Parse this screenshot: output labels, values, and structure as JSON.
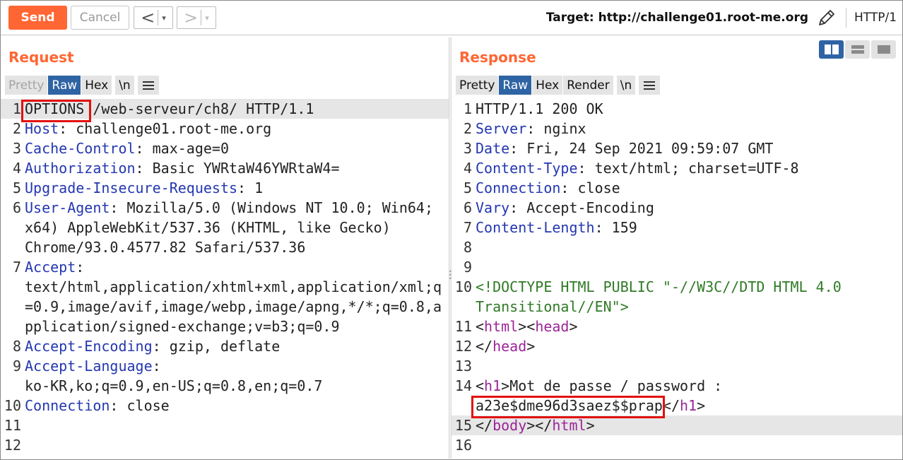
{
  "toolbar": {
    "send_label": "Send",
    "cancel_label": "Cancel",
    "back_arrow": "<",
    "forward_arrow": ">",
    "dropdown_arrow": "▾",
    "target_label": "Target: http://challenge01.root-me.org",
    "protocol_label": "HTTP/1"
  },
  "request": {
    "title": "Request",
    "tabs": [
      "Pretty",
      "Raw",
      "Hex",
      "\\n"
    ],
    "selected_tab": "Raw",
    "lines": [
      {
        "num": "1",
        "key": "OPTIONS",
        "rest": " /web-serveur/ch8/ HTTP/1.1"
      },
      {
        "num": "2",
        "key": "Host",
        "rest": ": challenge01.root-me.org"
      },
      {
        "num": "3",
        "key": "Cache-Control",
        "rest": ": max-age=0"
      },
      {
        "num": "4",
        "key": "Authorization",
        "rest": ": Basic YWRtaW46YWRtaW4="
      },
      {
        "num": "5",
        "key": "Upgrade-Insecure-Requests",
        "rest": ": 1"
      },
      {
        "num": "6",
        "key": "User-Agent",
        "rest": ": Mozilla/5.0 (Windows NT 10.0; Win64;"
      },
      {
        "num": "",
        "key": "",
        "rest": "x64) AppleWebKit/537.36 (KHTML, like Gecko)"
      },
      {
        "num": "",
        "key": "",
        "rest": "Chrome/93.0.4577.82 Safari/537.36"
      },
      {
        "num": "7",
        "key": "Accept",
        "rest": ":"
      },
      {
        "num": "",
        "key": "",
        "rest": "text/html,application/xhtml+xml,application/xml;q"
      },
      {
        "num": "",
        "key": "",
        "rest": "=0.9,image/avif,image/webp,image/apng,*/*;q=0.8,a"
      },
      {
        "num": "",
        "key": "",
        "rest": "pplication/signed-exchange;v=b3;q=0.9"
      },
      {
        "num": "8",
        "key": "Accept-Encoding",
        "rest": ": gzip, deflate"
      },
      {
        "num": "9",
        "key": "Accept-Language",
        "rest": ":"
      },
      {
        "num": "",
        "key": "",
        "rest": "ko-KR,ko;q=0.9,en-US;q=0.8,en;q=0.7"
      },
      {
        "num": "10",
        "key": "Connection",
        "rest": ": close"
      },
      {
        "num": "11",
        "key": "",
        "rest": ""
      },
      {
        "num": "12",
        "key": "",
        "rest": ""
      }
    ]
  },
  "response": {
    "title": "Response",
    "tabs": [
      "Pretty",
      "Raw",
      "Hex",
      "Render",
      "\\n"
    ],
    "selected_tab": "Raw",
    "lines": {
      "l1": "HTTP/1.1 200 OK",
      "l2k": "Server",
      "l2v": ": nginx",
      "l3k": "Date",
      "l3v": ": Fri, 24 Sep 2021 09:59:07 GMT",
      "l4k": "Content-Type",
      "l4v": ": text/html; charset=UTF-8",
      "l5k": "Connection",
      "l5v": ": close",
      "l6k": "Vary",
      "l6v": ": Accept-Encoding",
      "l7k": "Content-Length",
      "l7v": ": 159",
      "l10a": "<!DOCTYPE HTML PUBLIC \"-//W3C//DTD HTML 4.0",
      "l10b": "Transitional//EN\">",
      "l14": "Mot de passe / password :",
      "password": "a23e$dme96d3saez$$prap"
    }
  },
  "colors": {
    "accent": "#ff6633",
    "selected_tab": "#2f64a4",
    "header_key": "#2437b0",
    "doctype": "#2f7a25",
    "html_tag": "#9b2598",
    "highlight_box": "#e31010"
  }
}
